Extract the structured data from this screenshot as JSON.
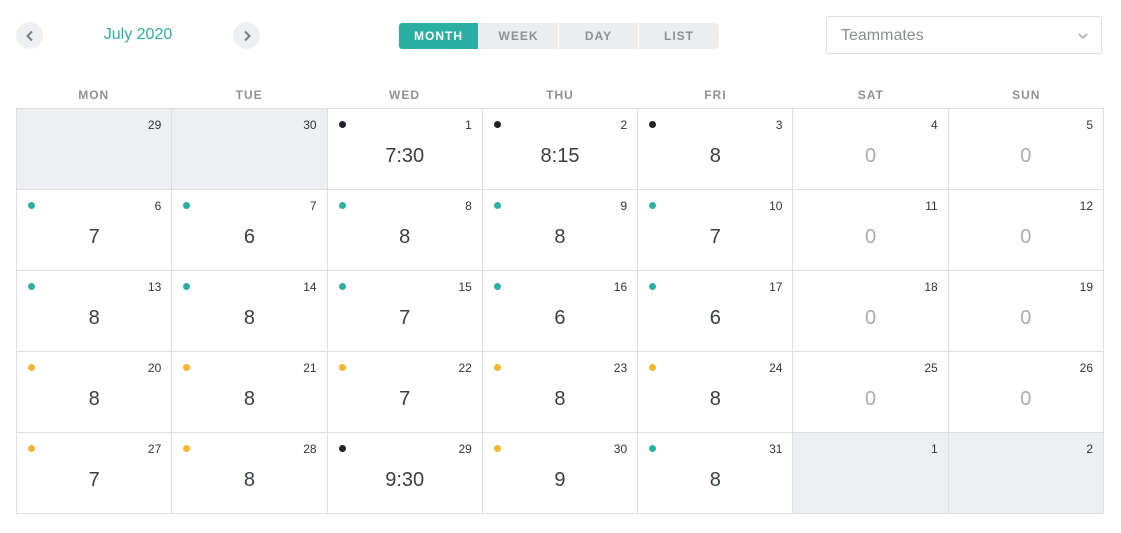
{
  "header": {
    "month_title": "July 2020",
    "views": [
      "MONTH",
      "WEEK",
      "DAY",
      "LIST"
    ],
    "active_view": "MONTH",
    "select_placeholder": "Teammates"
  },
  "weekdays": [
    "MON",
    "TUE",
    "WED",
    "THU",
    "FRI",
    "SAT",
    "SUN"
  ],
  "colors": {
    "accent": "#2bafa2",
    "dot_black": "#1f2228",
    "dot_teal": "#2bafa2",
    "dot_yellow": "#f5b52f",
    "outside_bg": "#eeeff1"
  },
  "days": [
    {
      "d": "29",
      "h": "",
      "dot": "",
      "out": true
    },
    {
      "d": "30",
      "h": "",
      "dot": "",
      "out": true
    },
    {
      "d": "1",
      "h": "7:30",
      "dot": "black"
    },
    {
      "d": "2",
      "h": "8:15",
      "dot": "black"
    },
    {
      "d": "3",
      "h": "8",
      "dot": "black"
    },
    {
      "d": "4",
      "h": "0",
      "dot": ""
    },
    {
      "d": "5",
      "h": "0",
      "dot": ""
    },
    {
      "d": "6",
      "h": "7",
      "dot": "teal"
    },
    {
      "d": "7",
      "h": "6",
      "dot": "teal"
    },
    {
      "d": "8",
      "h": "8",
      "dot": "teal"
    },
    {
      "d": "9",
      "h": "8",
      "dot": "teal"
    },
    {
      "d": "10",
      "h": "7",
      "dot": "teal"
    },
    {
      "d": "11",
      "h": "0",
      "dot": ""
    },
    {
      "d": "12",
      "h": "0",
      "dot": ""
    },
    {
      "d": "13",
      "h": "8",
      "dot": "teal"
    },
    {
      "d": "14",
      "h": "8",
      "dot": "teal"
    },
    {
      "d": "15",
      "h": "7",
      "dot": "teal"
    },
    {
      "d": "16",
      "h": "6",
      "dot": "teal"
    },
    {
      "d": "17",
      "h": "6",
      "dot": "teal"
    },
    {
      "d": "18",
      "h": "0",
      "dot": ""
    },
    {
      "d": "19",
      "h": "0",
      "dot": ""
    },
    {
      "d": "20",
      "h": "8",
      "dot": "yellow"
    },
    {
      "d": "21",
      "h": "8",
      "dot": "yellow"
    },
    {
      "d": "22",
      "h": "7",
      "dot": "yellow"
    },
    {
      "d": "23",
      "h": "8",
      "dot": "yellow"
    },
    {
      "d": "24",
      "h": "8",
      "dot": "yellow"
    },
    {
      "d": "25",
      "h": "0",
      "dot": ""
    },
    {
      "d": "26",
      "h": "0",
      "dot": ""
    },
    {
      "d": "27",
      "h": "7",
      "dot": "yellow"
    },
    {
      "d": "28",
      "h": "8",
      "dot": "yellow"
    },
    {
      "d": "29",
      "h": "9:30",
      "dot": "black"
    },
    {
      "d": "30",
      "h": "9",
      "dot": "yellow"
    },
    {
      "d": "31",
      "h": "8",
      "dot": "teal"
    },
    {
      "d": "1",
      "h": "",
      "dot": "",
      "out": true
    },
    {
      "d": "2",
      "h": "",
      "dot": "",
      "out": true
    }
  ]
}
